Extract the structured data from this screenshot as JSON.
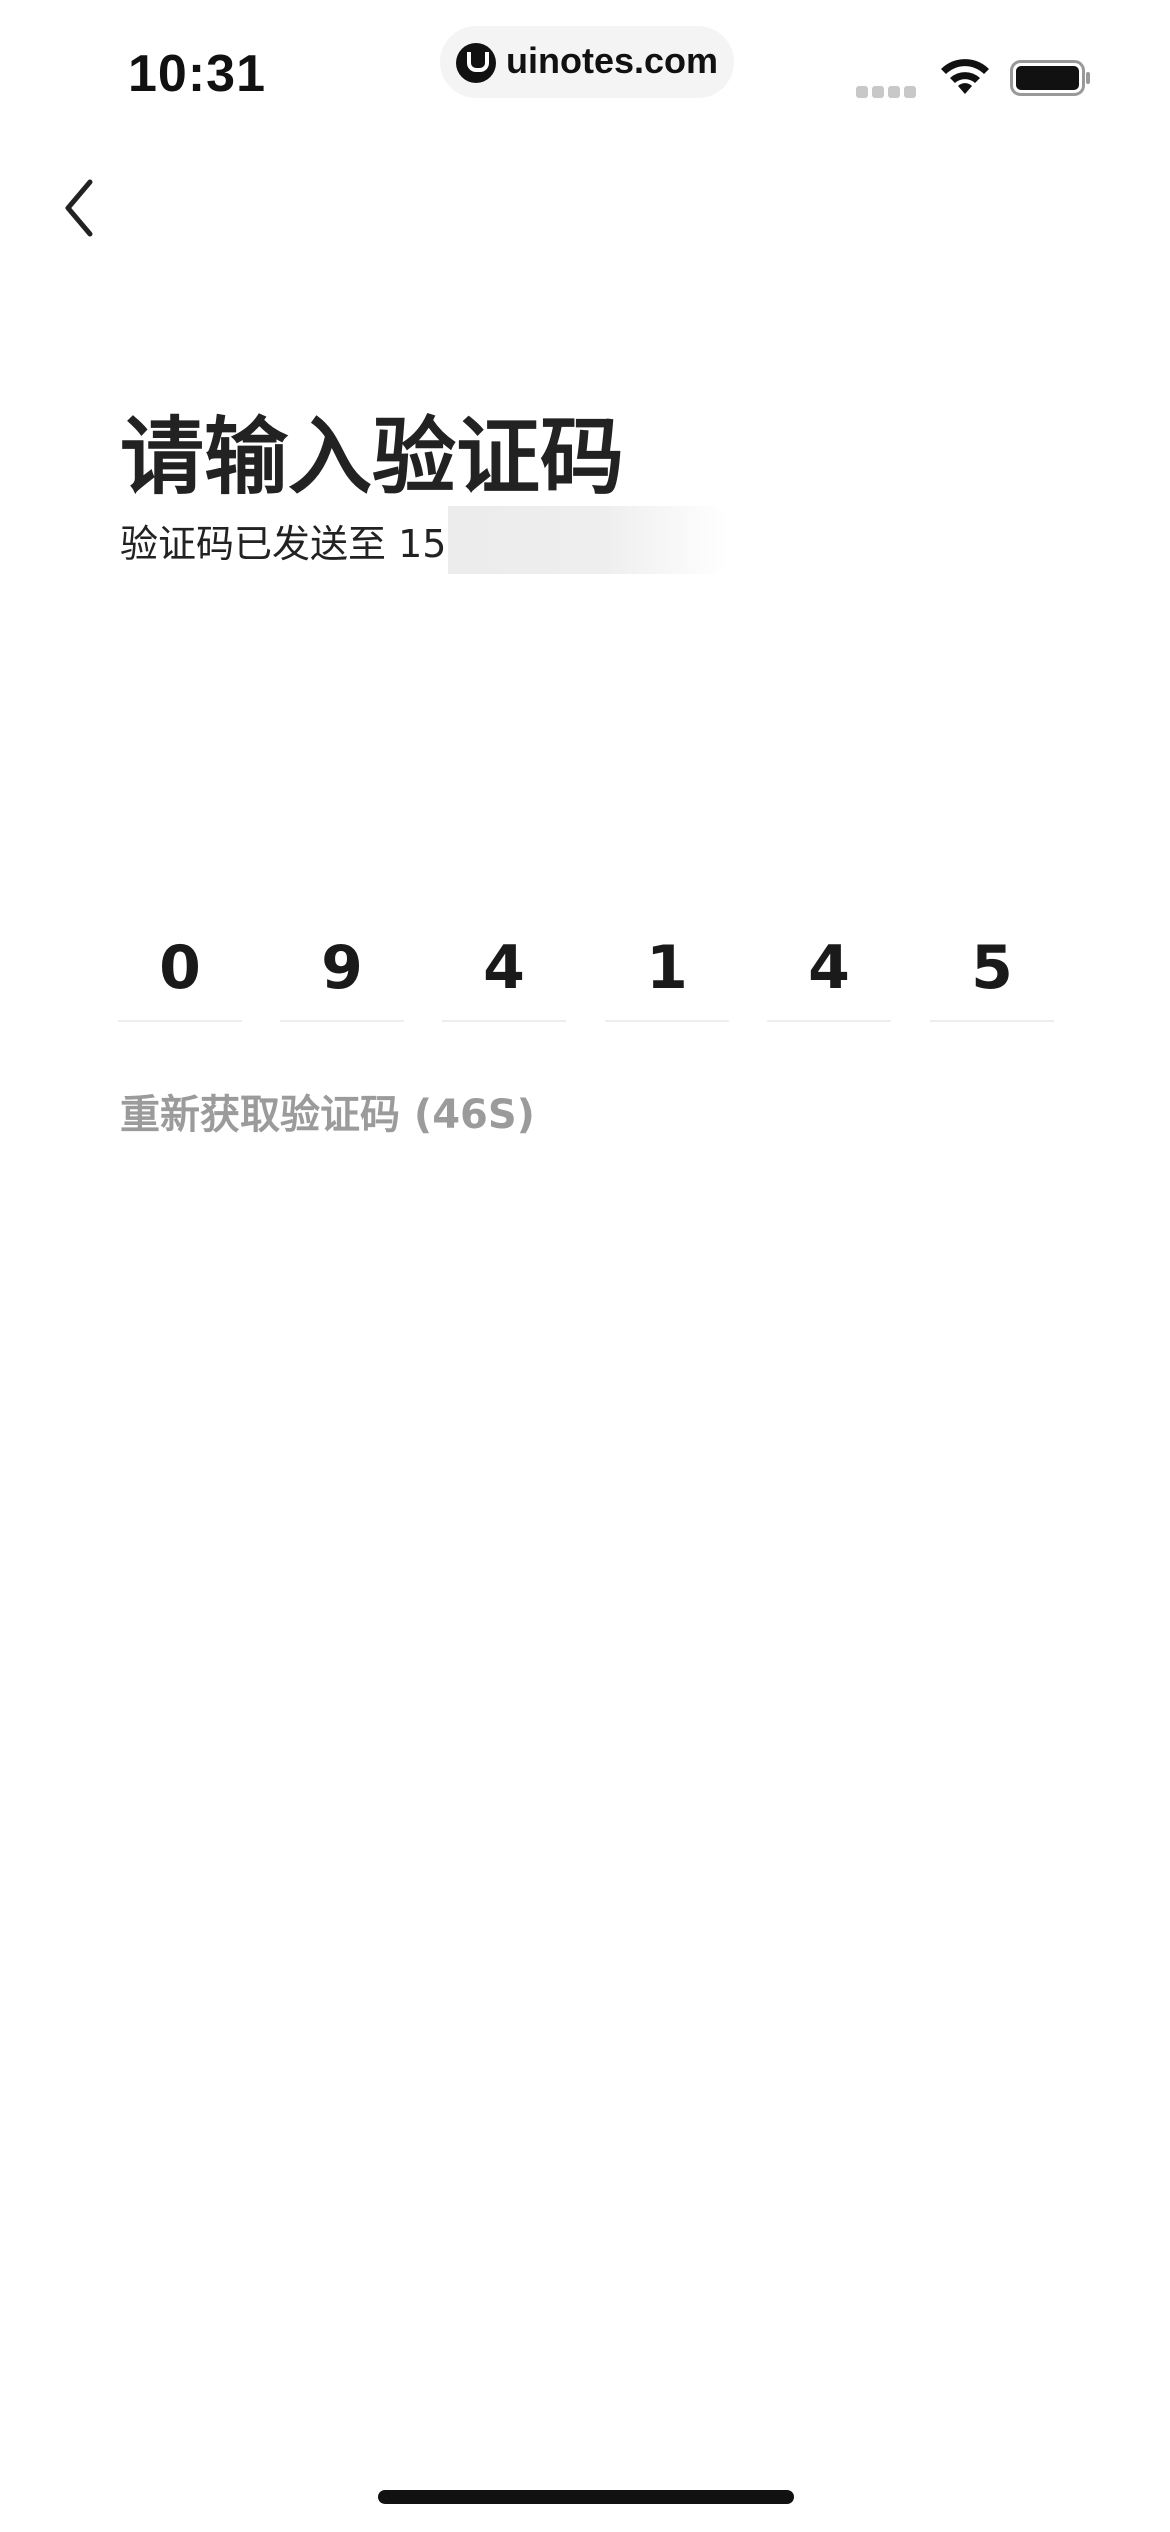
{
  "status_bar": {
    "time": "10:31",
    "url": "uinotes.com",
    "icons": [
      "signal-dots-icon",
      "wifi-icon",
      "battery-icon"
    ]
  },
  "nav": {
    "back_icon": "chevron-left-icon"
  },
  "header": {
    "title": "请输入验证码",
    "subtitle": "验证码已发送至 15"
  },
  "verification": {
    "digits": [
      "0",
      "9",
      "4",
      "1",
      "4",
      "5"
    ],
    "resend_label": "重新获取验证码 (46S)"
  },
  "colors": {
    "text_primary": "#222222",
    "text_muted": "#9b9b9b",
    "divider": "#eeeeee"
  }
}
